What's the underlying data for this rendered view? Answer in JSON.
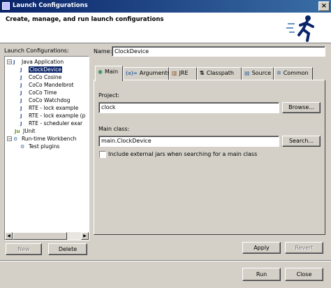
{
  "window": {
    "title": "Launch Configurations"
  },
  "header": {
    "title": "Create, manage, and run launch configurations",
    "icon": "running-man-icon"
  },
  "left": {
    "label": "Launch Configurations:",
    "tree": [
      {
        "label": "Java Application",
        "icon": "J",
        "expanded": "−"
      },
      {
        "label": "ClockDevice",
        "icon": "J"
      },
      {
        "label": "CoCo Cosine",
        "icon": "J"
      },
      {
        "label": "CoCo Mandelbrot",
        "icon": "J"
      },
      {
        "label": "CoCo Time",
        "icon": "J"
      },
      {
        "label": "CoCo Watchdog",
        "icon": "J"
      },
      {
        "label": "RTE - lock example",
        "icon": "J"
      },
      {
        "label": "RTE - lock example (p",
        "icon": "J"
      },
      {
        "label": "RTE - scheduler exar",
        "icon": "J"
      },
      {
        "label": "JUnit",
        "icon": "Ju"
      },
      {
        "label": "Run-time Workbench",
        "icon": "⚙",
        "expanded": "−"
      },
      {
        "label": "Test plugins",
        "icon": "⚙"
      }
    ],
    "new_label": "New",
    "delete_label": "Delete"
  },
  "main": {
    "name_label": "Name:",
    "name_value": "ClockDevice",
    "tabs": [
      {
        "label": "Main",
        "icon": "◉"
      },
      {
        "label": "Arguments",
        "icon": "(x)="
      },
      {
        "label": "JRE",
        "icon": "▥"
      },
      {
        "label": "Classpath",
        "icon": "⇅"
      },
      {
        "label": "Source",
        "icon": "▤"
      },
      {
        "label": "Common",
        "icon": "✲"
      }
    ],
    "project_label": "Project:",
    "project_value": "clock",
    "browse_label": "Browse...",
    "main_class_label": "Main class:",
    "main_class_value": "main.ClockDevice",
    "search_label": "Search...",
    "include_external_label": "Include external jars when searching for a main class",
    "apply_label": "Apply",
    "revert_label": "Revert"
  },
  "footer": {
    "run_label": "Run",
    "close_label": "Close"
  },
  "colors": {
    "titlebar": "#0a246a",
    "selection": "#0a246a",
    "face": "#d4d0c8"
  }
}
